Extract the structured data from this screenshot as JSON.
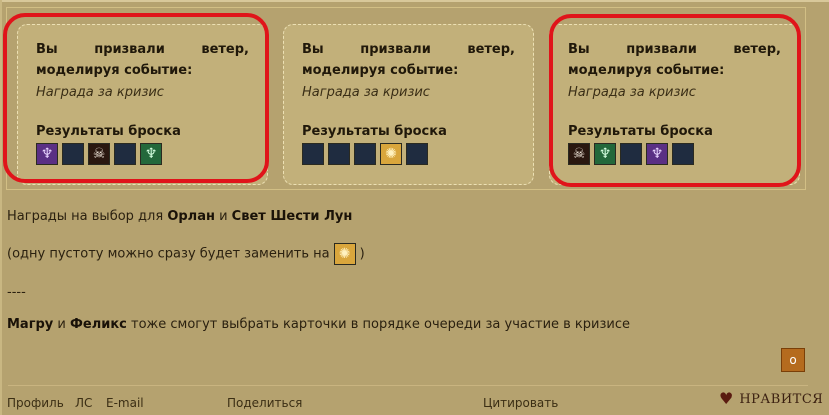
{
  "cards": [
    {
      "title": "Вы призвали ветер, моделируя событие:",
      "reward": "Награда за кризис",
      "results_title": "Результаты броска",
      "dice": [
        {
          "kind": "purple",
          "icon": "triquetra-icon",
          "glyph": "♆"
        },
        {
          "kind": "void",
          "icon": "void-icon",
          "glyph": ""
        },
        {
          "kind": "skull",
          "icon": "skull-icon",
          "glyph": "☠"
        },
        {
          "kind": "void",
          "icon": "void-icon",
          "glyph": ""
        },
        {
          "kind": "green",
          "icon": "triquetra-icon",
          "glyph": "♆"
        }
      ],
      "highlighted": true
    },
    {
      "title": "Вы призвали ветер, моделируя событие:",
      "reward": "Награда за кризис",
      "results_title": "Результаты броска",
      "dice": [
        {
          "kind": "void",
          "icon": "void-icon",
          "glyph": ""
        },
        {
          "kind": "void",
          "icon": "void-icon",
          "glyph": ""
        },
        {
          "kind": "void",
          "icon": "void-icon",
          "glyph": ""
        },
        {
          "kind": "gold",
          "icon": "sun-icon",
          "glyph": "✺"
        },
        {
          "kind": "void",
          "icon": "void-icon",
          "glyph": ""
        }
      ],
      "highlighted": false
    },
    {
      "title": "Вы призвали ветер, моделируя событие:",
      "reward": "Награда за кризис",
      "results_title": "Результаты броска",
      "dice": [
        {
          "kind": "skull",
          "icon": "skull-icon",
          "glyph": "☠"
        },
        {
          "kind": "green",
          "icon": "triquetra-icon",
          "glyph": "♆"
        },
        {
          "kind": "void",
          "icon": "void-icon",
          "glyph": ""
        },
        {
          "kind": "purple",
          "icon": "triquetra-icon",
          "glyph": "♆"
        },
        {
          "kind": "void",
          "icon": "void-icon",
          "glyph": ""
        }
      ],
      "highlighted": true
    }
  ],
  "post": {
    "line1_prefix": "Награды на выбор для ",
    "line1_name1": "Орлан",
    "line1_mid": " и ",
    "line1_name2": "Свет Шести Лун",
    "line2_prefix": "(одну пустоту можно сразу будет заменить на",
    "line2_suffix": ")",
    "separator": "----",
    "line3_name1": "Магру",
    "line3_mid": " и ",
    "line3_name2": "Феликс",
    "line3_suffix": " тоже смогут выбрать карточки в порядке очереди за участие в кризисе"
  },
  "quote_button_label": "o",
  "footer": {
    "profile": "Профиль",
    "pm": "ЛС",
    "email": "E-mail",
    "share": "Поделиться",
    "quote": "Цитировать",
    "like": "НРАВИТСЯ"
  },
  "colors": {
    "background": "#b5a26f",
    "card": "#c2b07a",
    "annotation": "#e0141a",
    "quote_button": "#b56b1e"
  }
}
